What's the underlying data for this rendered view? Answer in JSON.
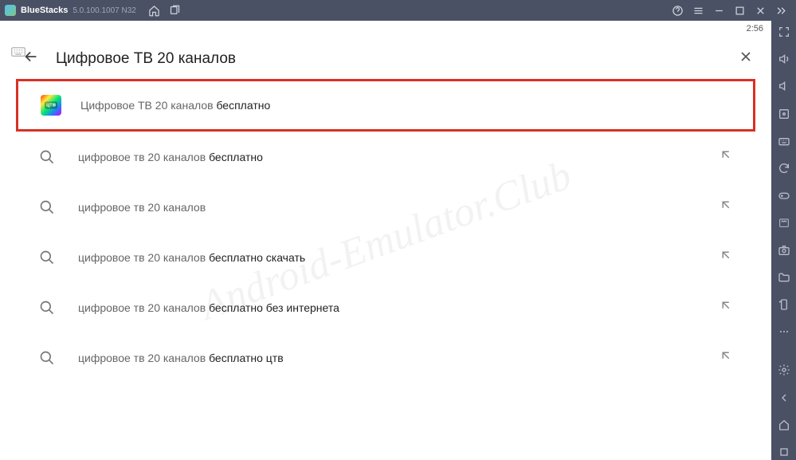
{
  "titlebar": {
    "name": "BlueStacks",
    "version": "5.0.100.1007 N32"
  },
  "status": {
    "time": "2:56"
  },
  "search": {
    "query": "Цифровое ТВ 20 каналов"
  },
  "results": [
    {
      "base": "Цифровое ТВ 20 каналов ",
      "bold": "бесплатно",
      "app": true,
      "highlight": true
    },
    {
      "base": "цифровое тв 20 каналов ",
      "bold": "бесплатно"
    },
    {
      "base": "цифровое тв 20 каналов",
      "bold": ""
    },
    {
      "base": "цифровое тв 20 каналов ",
      "bold": "бесплатно скачать"
    },
    {
      "base": "цифровое тв 20 каналов ",
      "bold": "бесплатно без интернета"
    },
    {
      "base": "цифровое тв 20 каналов ",
      "bold": "бесплатно цтв"
    }
  ],
  "watermark": "Android-Emulator.Club"
}
